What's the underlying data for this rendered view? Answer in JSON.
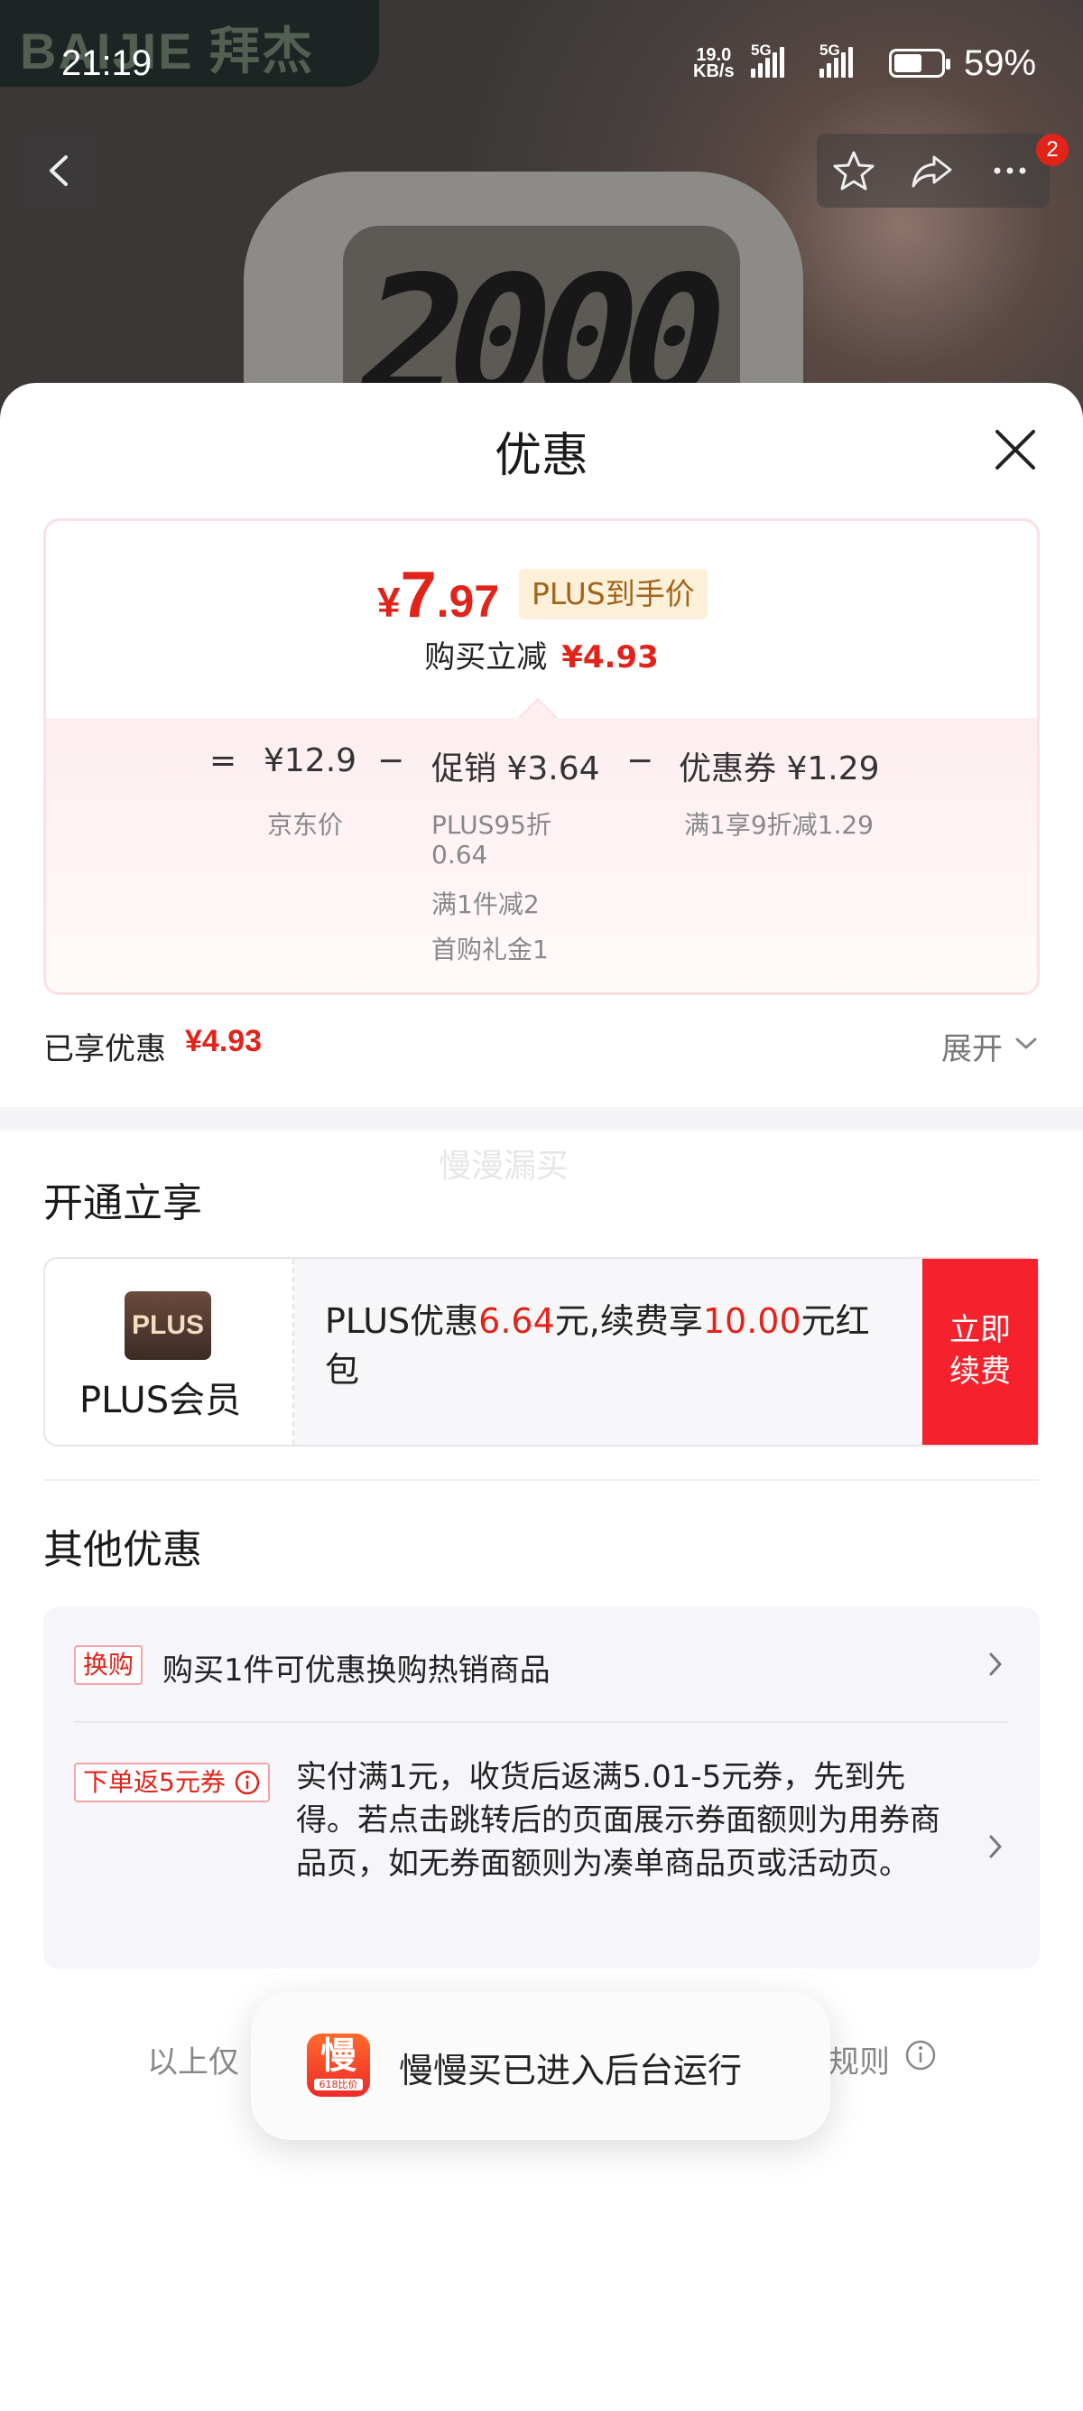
{
  "status_bar": {
    "time": "21:19",
    "net_speed_value": "19.0",
    "net_speed_unit": "KB/s",
    "signal1_label": "5G",
    "signal2_label": "5G",
    "battery_percent": 59,
    "battery_text": "59%"
  },
  "background": {
    "brand_text": "BAIJIE 拜杰",
    "device_digits": "2000"
  },
  "nav": {
    "cart_badge": "2"
  },
  "sheet": {
    "title": "优惠"
  },
  "price_card": {
    "currency": "¥",
    "price_integer": "7",
    "price_decimal": ".97",
    "plus_tag": "PLUS到手价",
    "save_label": "购买立减",
    "save_amount": "¥4.93",
    "formula": {
      "equals": "=",
      "jd_price": "¥12.9",
      "jd_price_label": "京东价",
      "minus1": "−",
      "promo": "促销 ¥3.64",
      "promo_details": [
        "PLUS95折",
        "0.64",
        "满1件减2",
        "首购礼金1"
      ],
      "minus2": "−",
      "coupon": "优惠券 ¥1.29",
      "coupon_detail": "满1享9折减1.29"
    }
  },
  "enjoyed": {
    "label": "已享优惠",
    "amount": "¥4.93",
    "expand": "展开"
  },
  "watermark": "慢漫漏买",
  "open_section": {
    "title": "开通立享",
    "plus_logo": "PLUS",
    "plus_member": "PLUS会员",
    "desc_prefix": "PLUS优惠",
    "desc_amount1": "6.64",
    "desc_mid": "元,续费享",
    "desc_amount2": "10.00",
    "desc_suffix": "元红包",
    "renew_line1": "立即",
    "renew_line2": "续费"
  },
  "other_section": {
    "title": "其他优惠",
    "offers": [
      {
        "tag": "换购",
        "text": "购买1件可优惠换购热销商品"
      },
      {
        "tag": "下单返5元券",
        "text": "实付满1元，收货后返满5.01-5元券，先到先得。若点击跳转后的页面展示券面额则为用券商品页，如无券面额则为凑单商品页或活动页。"
      }
    ]
  },
  "footer": {
    "note_visible": "以上仅",
    "rule": "规则"
  },
  "toast": {
    "icon_char": "慢",
    "icon_sub": "618比价",
    "text": "慢慢买已进入后台运行"
  },
  "colors": {
    "accent_red": "#e2231a",
    "plus_gold": "#a1641a",
    "renew_red": "#f5222d"
  }
}
